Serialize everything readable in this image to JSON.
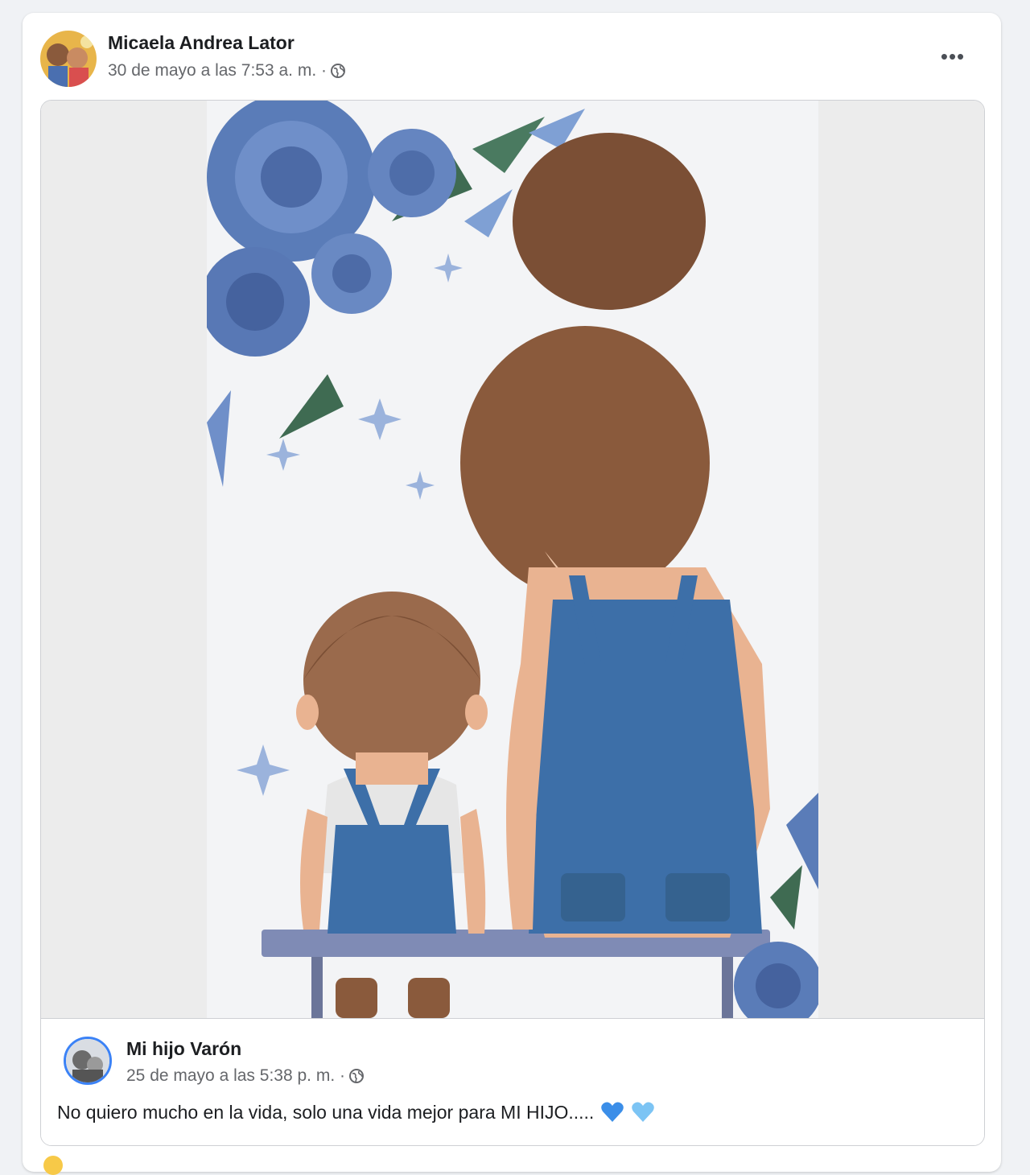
{
  "post": {
    "author": "Micaela Andrea Lator",
    "timestamp": "30 de mayo a las 7:53 a. m. ·",
    "privacy_icon": "globe-icon",
    "more_icon": "more-options-icon",
    "more_label": "•••"
  },
  "shared_post": {
    "author": "Mi hijo Varón",
    "timestamp": "25 de mayo a las 5:38 p. m. ·",
    "privacy_icon": "globe-icon",
    "text": "No quiero mucho en la vida, solo una vida mejor para MI HIJO.....",
    "emojis": [
      "blue-heart-icon",
      "light-blue-heart-icon"
    ]
  },
  "colors": {
    "page_bg": "#f0f2f5",
    "card_bg": "#ffffff",
    "secondary_text": "#65676b",
    "heart_blue": "#3b8ee8",
    "heart_light_blue": "#7cc4f4"
  }
}
